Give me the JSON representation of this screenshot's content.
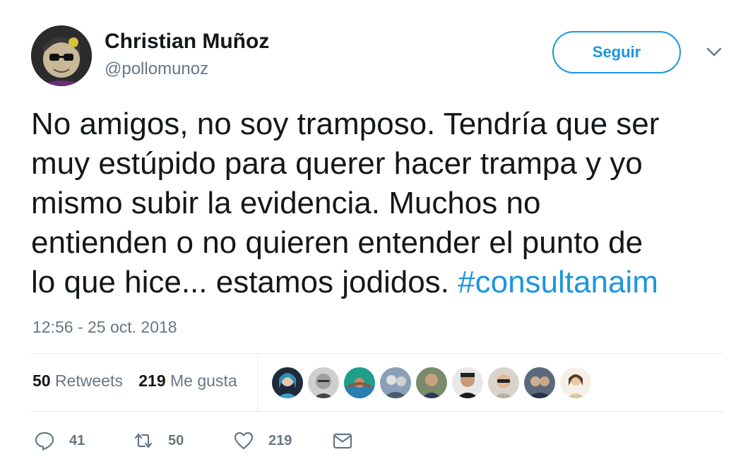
{
  "user": {
    "display_name": "Christian Muñoz",
    "handle": "@pollomunoz",
    "avatar_icon": "user-avatar"
  },
  "follow_button": {
    "label": "Seguir"
  },
  "tweet": {
    "text_lines": [
      "No amigos, no soy tramposo. Tendría que ser",
      "muy estúpido para querer hacer trampa y yo",
      "mismo subir la evidencia. Muchos no",
      "entienden o no quieren entender el punto de",
      "lo que hice... estamos jodidos. "
    ],
    "hashtag": "#consultanaim",
    "timestamp": "12:56 - 25 oct. 2018"
  },
  "stats": {
    "retweets": {
      "count": "50",
      "label": "Retweets"
    },
    "likes": {
      "count": "219",
      "label": "Me gusta"
    }
  },
  "liked_by_avatars": [
    {
      "icon": "liker-avatar-1"
    },
    {
      "icon": "liker-avatar-2"
    },
    {
      "icon": "liker-avatar-3"
    },
    {
      "icon": "liker-avatar-4"
    },
    {
      "icon": "liker-avatar-5"
    },
    {
      "icon": "liker-avatar-6"
    },
    {
      "icon": "liker-avatar-7"
    },
    {
      "icon": "liker-avatar-8"
    },
    {
      "icon": "liker-avatar-9"
    }
  ],
  "actions": {
    "reply": {
      "icon": "reply-icon",
      "count": "41"
    },
    "retweet": {
      "icon": "retweet-icon",
      "count": "50"
    },
    "like": {
      "icon": "heart-icon",
      "count": "219"
    },
    "message": {
      "icon": "envelope-icon"
    }
  },
  "colors": {
    "accent": "#1b95e0",
    "text": "#14171a",
    "secondary": "#657786",
    "divider": "#e6ecf0"
  }
}
